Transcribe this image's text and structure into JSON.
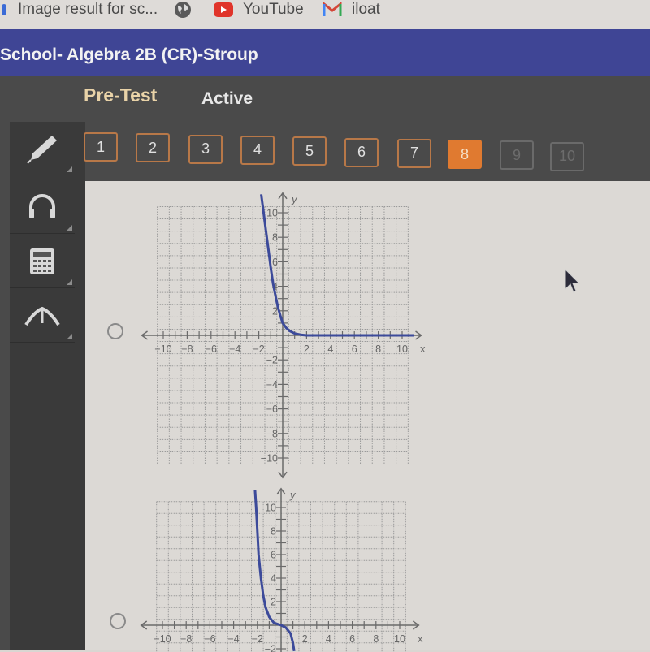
{
  "bookmarks": [
    {
      "label": "Image result for sc...",
      "icon": "image-favicon"
    },
    {
      "label": "",
      "icon": "globe-icon"
    },
    {
      "label": "YouTube",
      "icon": "youtube-icon"
    },
    {
      "label": "iloat",
      "icon": "gmail-icon"
    }
  ],
  "course_title": "School- Algebra 2B (CR)-Stroup",
  "activity": {
    "title": "Pre-Test",
    "status": "Active"
  },
  "tools": [
    {
      "name": "pencil-tool",
      "icon": "pencil-icon"
    },
    {
      "name": "audio-tool",
      "icon": "headphones-icon"
    },
    {
      "name": "calculator-tool",
      "icon": "calculator-icon"
    },
    {
      "name": "reference-tool",
      "icon": "compass-icon"
    }
  ],
  "questions": [
    {
      "label": "1",
      "state": "answered"
    },
    {
      "label": "2",
      "state": "answered"
    },
    {
      "label": "3",
      "state": "answered"
    },
    {
      "label": "4",
      "state": "answered"
    },
    {
      "label": "5",
      "state": "answered"
    },
    {
      "label": "6",
      "state": "answered"
    },
    {
      "label": "7",
      "state": "answered"
    },
    {
      "label": "8",
      "state": "current"
    },
    {
      "label": "9",
      "state": "locked"
    },
    {
      "label": "10",
      "state": "locked"
    }
  ],
  "colors": {
    "accent": "#e07a30",
    "header": "#3f4595",
    "curve": "#3c4a9a"
  },
  "chart_data": [
    {
      "type": "line",
      "title": "",
      "xlabel": "x",
      "ylabel": "y",
      "xlim": [
        -10,
        10
      ],
      "ylim": [
        -10,
        10
      ],
      "grid": true,
      "x_ticks": [
        "-10",
        "-8",
        "-6",
        "-4",
        "-2",
        "2",
        "4",
        "6",
        "8",
        "10"
      ],
      "y_ticks": [
        "10",
        "8",
        "6",
        "4",
        "2",
        "-2",
        "-4",
        "-6",
        "-8",
        "-10"
      ],
      "series": [
        {
          "name": "option-a-curve",
          "points": [
            [
              -1.8,
              11.5
            ],
            [
              -1.6,
              10
            ],
            [
              -1.4,
              8.5
            ],
            [
              -1.2,
              7
            ],
            [
              -1,
              5.5
            ],
            [
              -0.8,
              4.2
            ],
            [
              -0.6,
              3.2
            ],
            [
              -0.4,
              2.3
            ],
            [
              -0.2,
              1.6
            ],
            [
              0,
              1
            ],
            [
              0.3,
              0.6
            ],
            [
              0.6,
              0.35
            ],
            [
              1,
              0.15
            ],
            [
              1.5,
              0.05
            ],
            [
              2,
              0
            ],
            [
              4,
              0
            ],
            [
              6,
              0
            ],
            [
              8,
              0
            ],
            [
              10,
              0
            ],
            [
              11,
              0
            ]
          ]
        }
      ],
      "choice_selected": false
    },
    {
      "type": "line",
      "title": "",
      "xlabel": "x",
      "ylabel": "y",
      "xlim": [
        -10,
        10
      ],
      "ylim": [
        -10,
        10
      ],
      "grid": true,
      "x_ticks": [
        "-10",
        "-8",
        "-6",
        "-4",
        "-2",
        "2",
        "4",
        "6",
        "8",
        "10"
      ],
      "y_ticks": [
        "10",
        "8",
        "6",
        "4",
        "2",
        "-2"
      ],
      "series": [
        {
          "name": "option-b-curve",
          "points": [
            [
              -2.2,
              11.5
            ],
            [
              -2.1,
              10
            ],
            [
              -2,
              8
            ],
            [
              -1.9,
              6
            ],
            [
              -1.7,
              4
            ],
            [
              -1.5,
              2.5
            ],
            [
              -1.3,
              1.5
            ],
            [
              -1,
              0.7
            ],
            [
              -0.6,
              0.2
            ],
            [
              0,
              0
            ],
            [
              0.4,
              -0.2
            ],
            [
              0.8,
              -0.7
            ],
            [
              1,
              -1.5
            ],
            [
              1.1,
              -2.2
            ]
          ]
        }
      ],
      "choice_selected": false
    }
  ]
}
